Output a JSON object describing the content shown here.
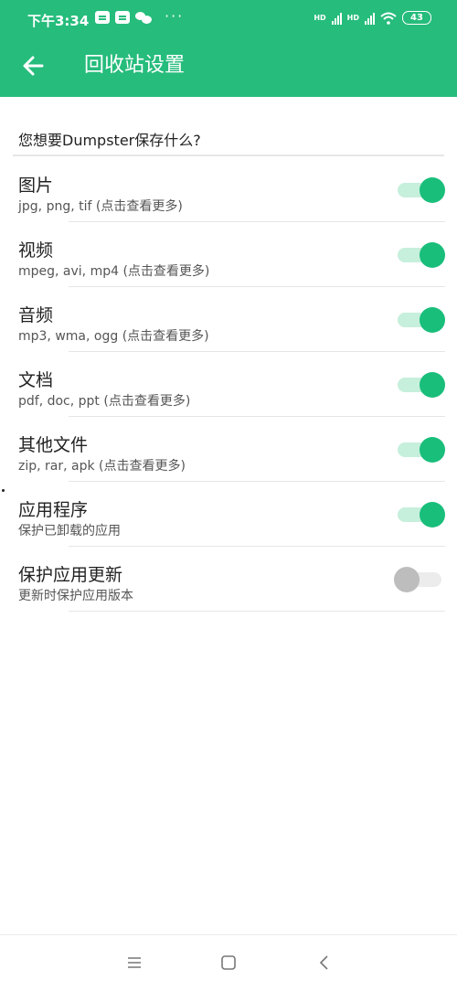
{
  "status": {
    "time": "下午3:34",
    "signal1_label": "HD",
    "signal2_label": "HD",
    "battery": "43",
    "more_dots": "···"
  },
  "header": {
    "title": "回收站设置",
    "accent_color": "#26bc7c"
  },
  "section": {
    "question": "您想要Dumpster保存什么?"
  },
  "items": [
    {
      "title": "图片",
      "subtitle": "jpg, png, tif (点击查看更多)",
      "enabled": true
    },
    {
      "title": "视频",
      "subtitle": "mpeg, avi, mp4 (点击查看更多)",
      "enabled": true
    },
    {
      "title": "音频",
      "subtitle": "mp3, wma, ogg (点击查看更多)",
      "enabled": true
    },
    {
      "title": "文档",
      "subtitle": "pdf, doc, ppt (点击查看更多)",
      "enabled": true
    },
    {
      "title": "其他文件",
      "subtitle": "zip, rar, apk (点击查看更多)",
      "enabled": true
    },
    {
      "title": "应用程序",
      "subtitle": "保护已卸载的应用",
      "enabled": true
    },
    {
      "title": "保护应用更新",
      "subtitle": "更新时保护应用版本",
      "enabled": false
    }
  ],
  "navbar": {
    "icons": [
      "menu-icon",
      "home-square-icon",
      "back-chevron-icon"
    ]
  }
}
